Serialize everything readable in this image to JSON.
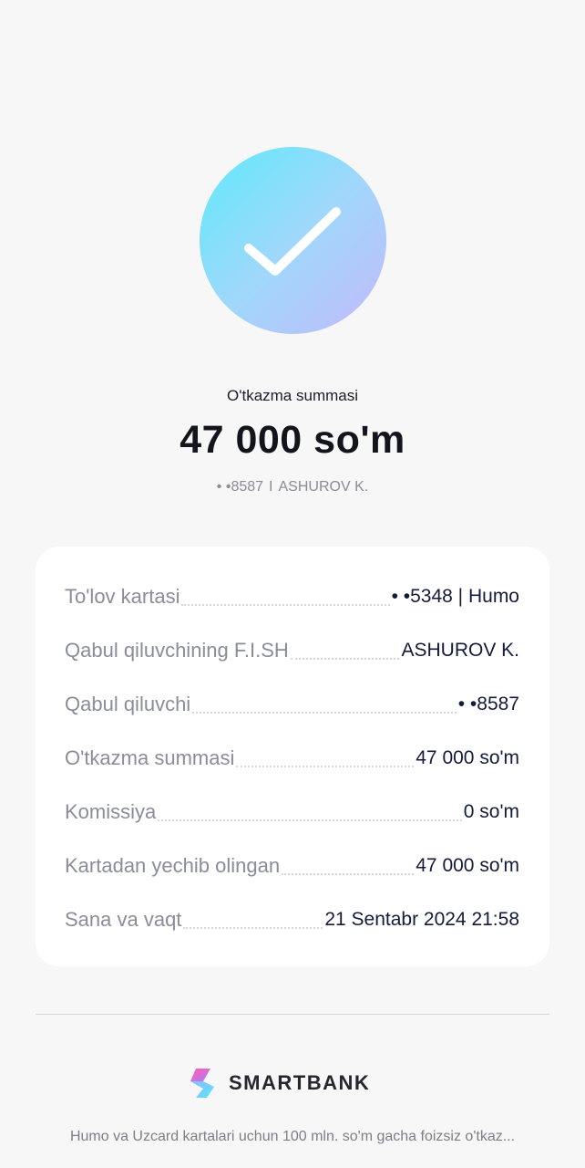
{
  "status": {
    "icon": "checkmark-icon",
    "amount_label": "O'tkazma summasi",
    "amount": "47 000 so'm",
    "recipient_card": "• •8587",
    "separator": "I",
    "recipient_name": "ASHUROV K."
  },
  "details": {
    "rows": [
      {
        "label": "To'lov kartasi",
        "value": "• •5348 | Humo"
      },
      {
        "label": "Qabul qiluvchining F.I.SH",
        "value": "ASHUROV K."
      },
      {
        "label": "Qabul qiluvchi",
        "value": "• •8587"
      },
      {
        "label": "O'tkazma summasi",
        "value": "47 000 so'm"
      },
      {
        "label": "Komissiya",
        "value": "0 so'm"
      },
      {
        "label": "Kartadan yechib olingan",
        "value": "47 000 so'm"
      },
      {
        "label": "Sana va vaqt",
        "value": "21 Sentabr 2024 21:58"
      }
    ]
  },
  "footer": {
    "logo_icon": "smartbank-logo-icon",
    "brand": "SMARTBANK",
    "promo_text": "Humo va Uzcard kartalari uchun 100 mln. so'm gacha foizsiz o'tkaz..."
  },
  "colors": {
    "background": "#f7f7f8",
    "card": "#ffffff",
    "value_text": "#141a3a",
    "label_text": "#8a8c99",
    "check_gradient_start": "#5ee9fb",
    "check_gradient_end": "#c4b9fb"
  }
}
